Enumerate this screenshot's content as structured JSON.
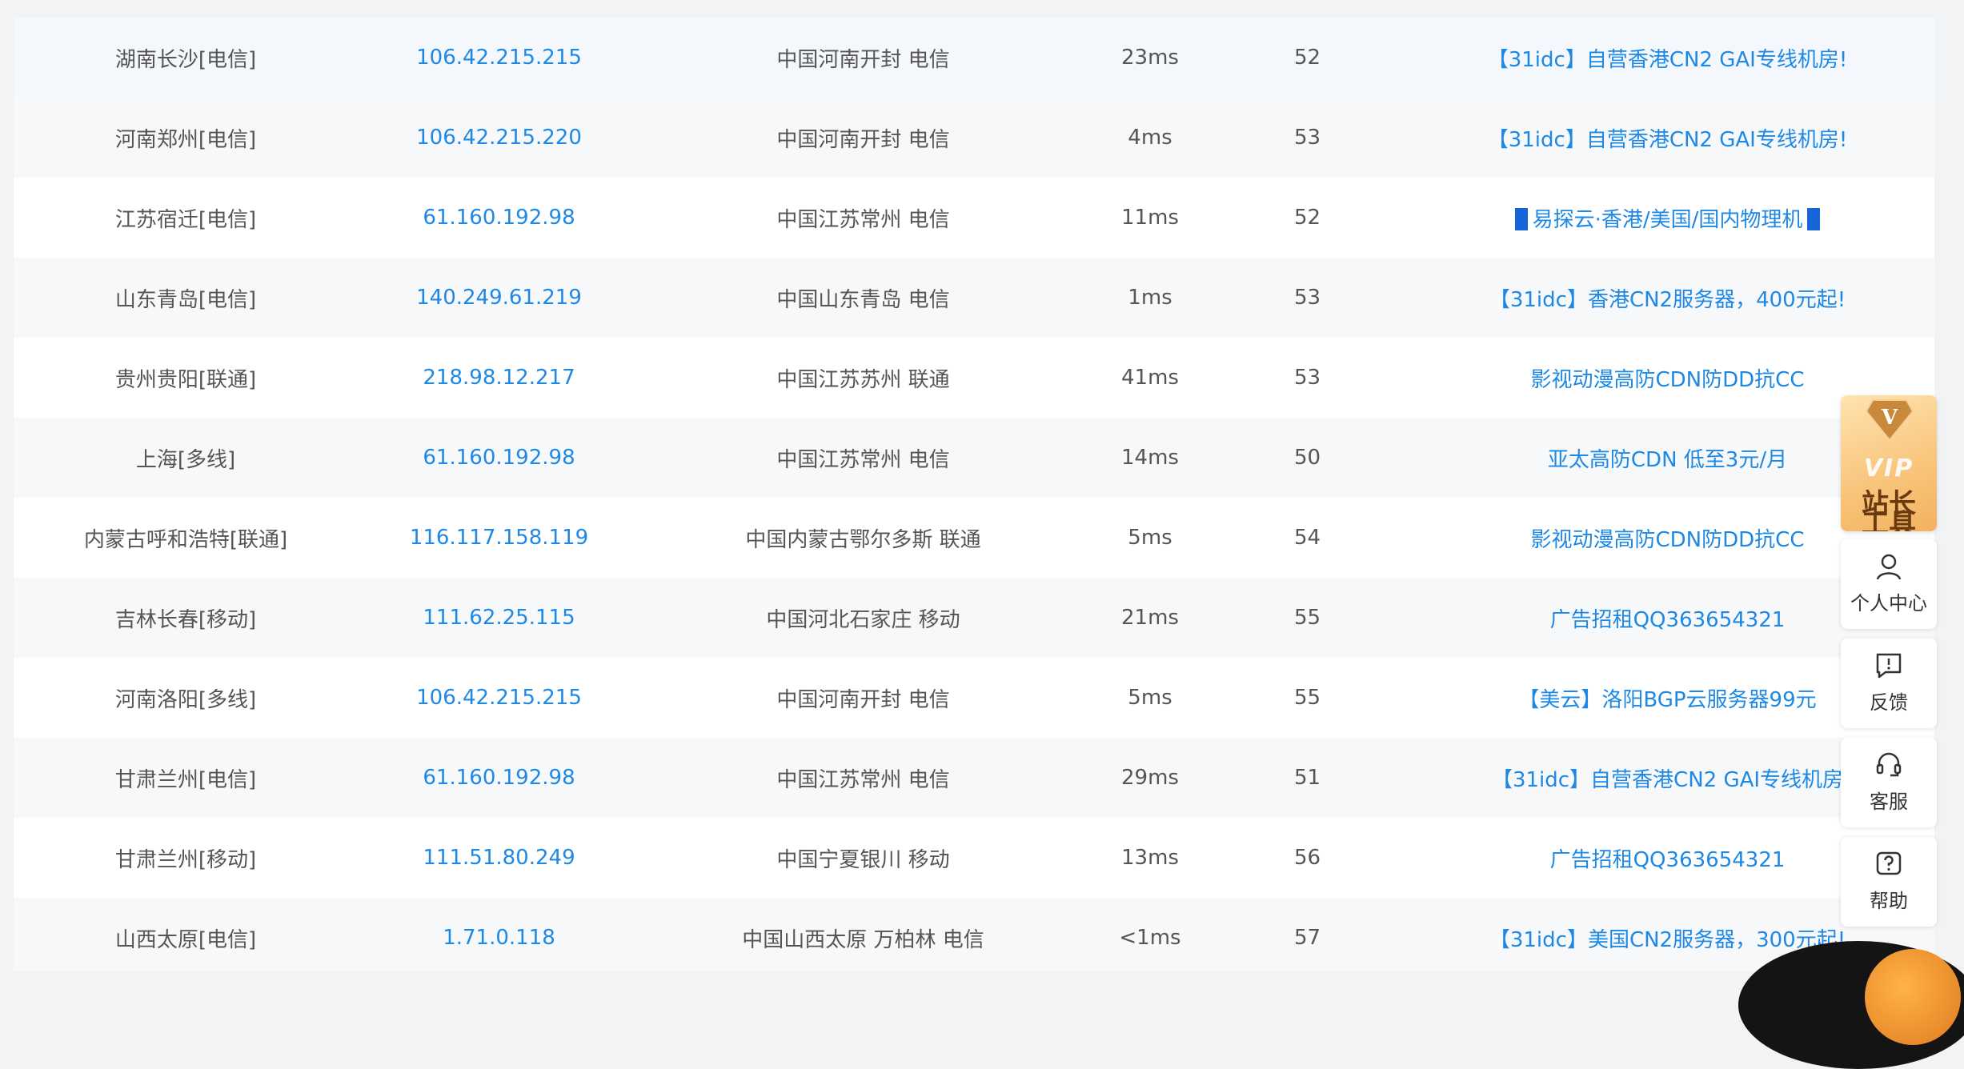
{
  "rows": [
    {
      "node": "湖南长沙[电信]",
      "ip": "106.42.215.215",
      "location": "中国河南开封 电信",
      "time": "23ms",
      "ttl": "52",
      "ad": "【31idc】自营香港CN2 GAI专线机房!"
    },
    {
      "node": "河南郑州[电信]",
      "ip": "106.42.215.220",
      "location": "中国河南开封 电信",
      "time": "4ms",
      "ttl": "53",
      "ad": "【31idc】自营香港CN2 GAI专线机房!"
    },
    {
      "node": "江苏宿迁[电信]",
      "ip": "61.160.192.98",
      "location": "中国江苏常州 电信",
      "time": "11ms",
      "ttl": "52",
      "ad": "易探云·香港/美国/国内物理机"
    },
    {
      "node": "山东青岛[电信]",
      "ip": "140.249.61.219",
      "location": "中国山东青岛 电信",
      "time": "1ms",
      "ttl": "53",
      "ad": "【31idc】香港CN2服务器，400元起!"
    },
    {
      "node": "贵州贵阳[联通]",
      "ip": "218.98.12.217",
      "location": "中国江苏苏州 联通",
      "time": "41ms",
      "ttl": "53",
      "ad": "影视动漫高防CDN防DD抗CC"
    },
    {
      "node": "上海[多线]",
      "ip": "61.160.192.98",
      "location": "中国江苏常州 电信",
      "time": "14ms",
      "ttl": "50",
      "ad": "亚太高防CDN 低至3元/月"
    },
    {
      "node": "内蒙古呼和浩特[联通]",
      "ip": "116.117.158.119",
      "location": "中国内蒙古鄂尔多斯 联通",
      "time": "5ms",
      "ttl": "54",
      "ad": "影视动漫高防CDN防DD抗CC"
    },
    {
      "node": "吉林长春[移动]",
      "ip": "111.62.25.115",
      "location": "中国河北石家庄 移动",
      "time": "21ms",
      "ttl": "55",
      "ad": "广告招租QQ363654321"
    },
    {
      "node": "河南洛阳[多线]",
      "ip": "106.42.215.215",
      "location": "中国河南开封 电信",
      "time": "5ms",
      "ttl": "55",
      "ad": "【美云】洛阳BGP云服务器99元"
    },
    {
      "node": "甘肃兰州[电信]",
      "ip": "61.160.192.98",
      "location": "中国江苏常州 电信",
      "time": "29ms",
      "ttl": "51",
      "ad": "【31idc】自营香港CN2 GAI专线机房"
    },
    {
      "node": "甘肃兰州[移动]",
      "ip": "111.51.80.249",
      "location": "中国宁夏银川 移动",
      "time": "13ms",
      "ttl": "56",
      "ad": "广告招租QQ363654321"
    },
    {
      "node": "山西太原[电信]",
      "ip": "1.71.0.118",
      "location": "中国山西太原 万柏林 电信",
      "time": "<1ms",
      "ttl": "57",
      "ad": "【31idc】美国CN2服务器，300元起!"
    }
  ],
  "sidebar": {
    "vip_latin": "VIP",
    "vip_line1": "站长",
    "vip_line2": "工具",
    "vip_badge_letter": "V",
    "tools": [
      {
        "label": "个人中心",
        "icon": "user-icon"
      },
      {
        "label": "反馈",
        "icon": "feedback-icon"
      },
      {
        "label": "客服",
        "icon": "headset-icon"
      },
      {
        "label": "帮助",
        "icon": "help-icon"
      }
    ]
  },
  "colors": {
    "link": "#1e88e5",
    "text": "#555555",
    "vip_gold": "#f8c47a"
  }
}
